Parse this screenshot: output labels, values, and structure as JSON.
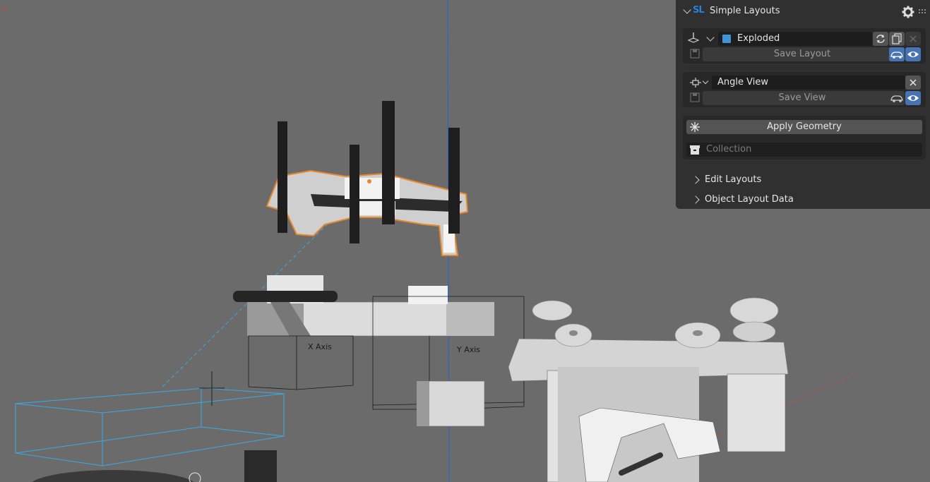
{
  "panel": {
    "title": "Simple Layouts",
    "logo": "SL",
    "layout_name": "Exploded",
    "layout_color": "#3d95d6",
    "save_layout_label": "Save Layout",
    "view_name": "Angle View",
    "save_view_label": "Save View",
    "apply_geometry_label": "Apply Geometry",
    "collection_placeholder": "Collection",
    "edit_layouts_label": "Edit Layouts",
    "object_layout_data_label": "Object Layout Data"
  },
  "viewport": {
    "x_axis_label": "X Axis",
    "y_axis_label": "Y Axis",
    "selection_color": "#e8882a",
    "camera_color": "#3aaae8"
  },
  "icons": [
    "settings-gear-icon",
    "grip-icon",
    "ground-plane-icon",
    "dropdown-chevron-icon",
    "refresh-icon",
    "duplicate-icon",
    "close-icon",
    "save-icon",
    "car-icon",
    "eye-icon",
    "camera-move-icon",
    "snowflake-icon",
    "collection-box-icon",
    "expand-chevron-icon"
  ]
}
